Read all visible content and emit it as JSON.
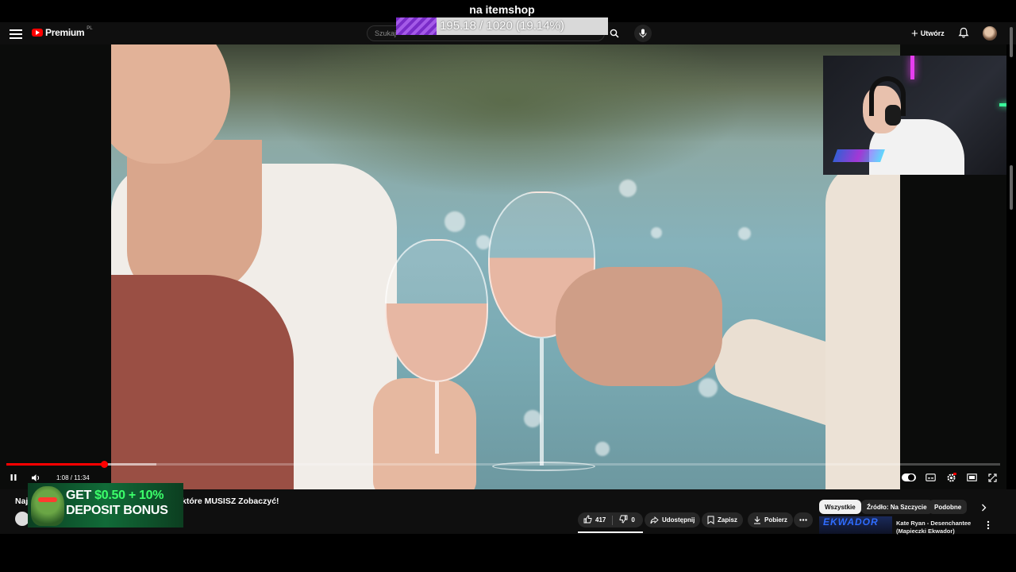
{
  "overlay": {
    "goal_title": "na itemshop",
    "goal_text": "195.18 / 1020 (19.14%)",
    "goal_fraction": 0.1914
  },
  "header": {
    "logo_text": "Premium",
    "region": "PL",
    "search_placeholder": "Szukaj",
    "create_label": "Utwórz"
  },
  "player": {
    "time_display": "1:08 / 11:34",
    "played_fraction": 0.098,
    "buffered_fraction": 0.151
  },
  "video": {
    "title_visible_start": "Naj",
    "title_visible_end": "które MUSISZ Zobaczyć!"
  },
  "ad": {
    "line1_prefix": "GET ",
    "line1_highlight": "$0.50 + 10%",
    "line2": "DEPOSIT BONUS"
  },
  "actions": {
    "likes": "417",
    "dislikes": "0",
    "share_label": "Udostępnij",
    "save_label": "Zapisz",
    "download_label": "Pobierz"
  },
  "chips": {
    "all": "Wszystkie",
    "source": "Źródło: Na Szczycie",
    "similar": "Podobne"
  },
  "recommendation": {
    "thumb_text": "EKWADOR",
    "title": "Kate Ryan - Desenchantee (Mapieczki Ekwador)"
  },
  "icons": {
    "menu": "menu-icon",
    "search": "search-icon",
    "mic": "mic-icon",
    "bell": "bell-icon",
    "pause": "pause-icon",
    "volume": "volume-icon",
    "subtitles": "subtitles-icon",
    "settings": "gear-icon",
    "miniplayer": "miniplayer-icon",
    "fullscreen": "fullscreen-icon"
  },
  "colors": {
    "accent": "#ff0000",
    "goal_fill": "#7a2cc8"
  }
}
